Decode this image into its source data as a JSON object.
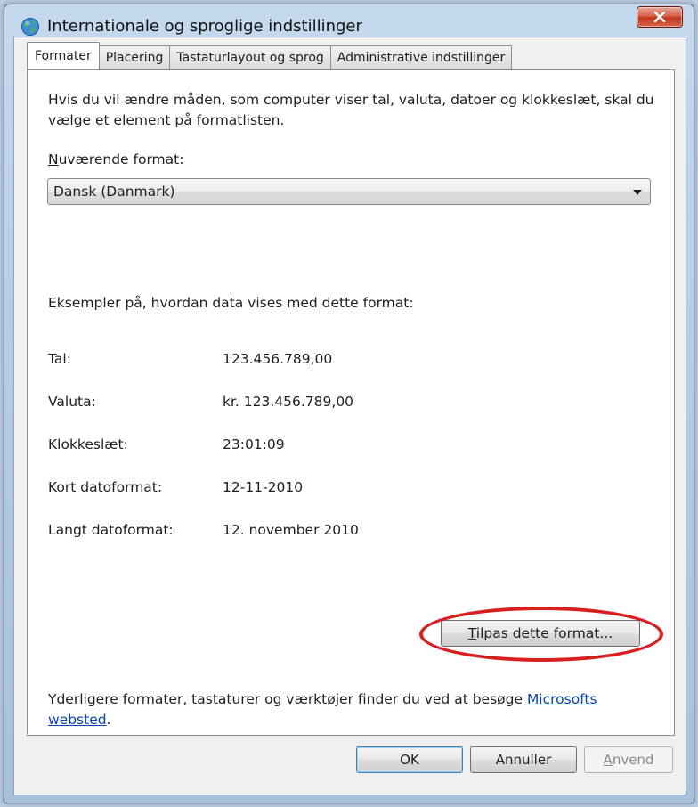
{
  "window": {
    "title": "Internationale og sproglige indstillinger"
  },
  "tabs": [
    {
      "label": "Formater",
      "active": true
    },
    {
      "label": "Placering",
      "active": false
    },
    {
      "label": "Tastaturlayout og sprog",
      "active": false
    },
    {
      "label": "Administrative indstillinger",
      "active": false
    }
  ],
  "formats": {
    "description": "Hvis du vil ændre måden, som computer viser tal, valuta, datoer og klokkeslæt, skal du vælge et element på formatlisten.",
    "current_format_label_first": "N",
    "current_format_label_rest": "uværende format:",
    "current_format_value": "Dansk (Danmark)",
    "examples_title": "Eksempler på, hvordan data vises med dette format:",
    "examples": [
      {
        "label": "Tal:",
        "value": "123.456.789,00"
      },
      {
        "label": "Valuta:",
        "value": "kr. 123.456.789,00"
      },
      {
        "label": "Klokkeslæt:",
        "value": "23:01:09"
      },
      {
        "label": "Kort datoformat:",
        "value": "12-11-2010"
      },
      {
        "label": "Langt datoformat:",
        "value": "12. november 2010"
      }
    ],
    "customize_button_first": "T",
    "customize_button_rest": "ilpas dette format...",
    "footer_text": "Yderligere formater, tastaturer og værktøjer finder du ved at besøge ",
    "footer_link_1": "Microsofts",
    "footer_link_2": "websted",
    "footer_end": "."
  },
  "buttons": {
    "ok": "OK",
    "cancel": "Annuller",
    "apply_first": "A",
    "apply_rest": "nvend"
  },
  "colors": {
    "annotation_ellipse": "#d81e1e",
    "link": "#0645ad",
    "close_button": "#c2371d"
  }
}
